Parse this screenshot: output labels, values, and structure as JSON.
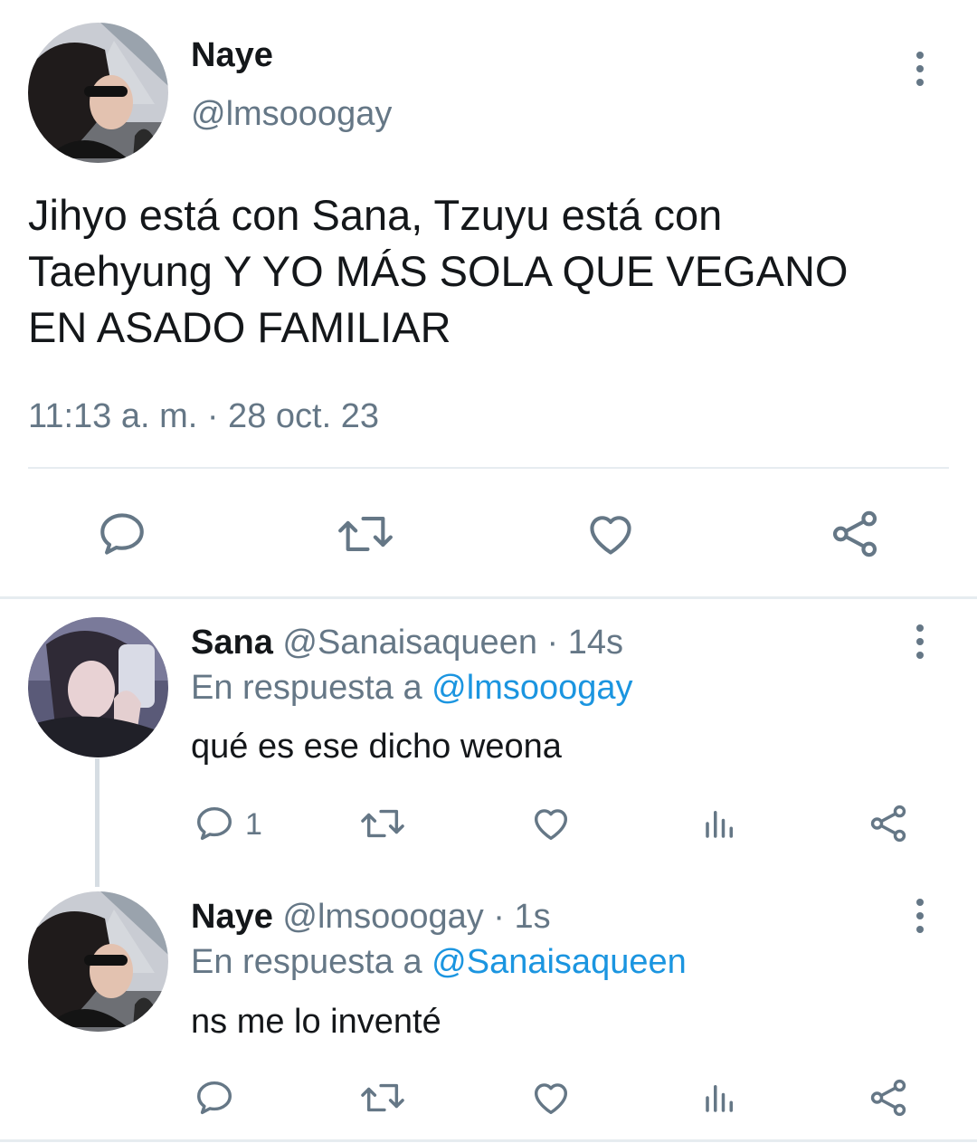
{
  "main_tweet": {
    "display_name": "Naye",
    "handle": "@lmsooogay",
    "text_lines": [
      "Jihyo está con Sana, Tzuyu está con",
      "Taehyung Y YO MÁS SOLA QUE VEGANO",
      "EN ASADO FAMILIAR"
    ],
    "timestamp": "11:13 a. m. · 28 oct. 23",
    "actions": [
      "reply-icon",
      "retweet-icon",
      "like-icon",
      "share-icon"
    ]
  },
  "replies": [
    {
      "display_name": "Sana",
      "handle_time": "@Sanaisaqueen · 14s",
      "reply_prefix": "En respuesta a ",
      "reply_to": "@lmsooogay",
      "text": "qué es ese dicho weona",
      "reply_count": "1",
      "actions": [
        "reply-icon",
        "retweet-icon",
        "like-icon",
        "analytics-icon",
        "share-icon"
      ]
    },
    {
      "display_name": "Naye",
      "handle_time": "@lmsooogay · 1s",
      "reply_prefix": "En respuesta a ",
      "reply_to": "@Sanaisaqueen",
      "text": "ns me lo inventé",
      "reply_count": "",
      "actions": [
        "reply-icon",
        "retweet-icon",
        "like-icon",
        "analytics-icon",
        "share-icon"
      ]
    }
  ],
  "colors": {
    "text": "#14171a",
    "secondary": "#657786",
    "link": "#1b95e0",
    "divider": "#e6ecf0"
  }
}
